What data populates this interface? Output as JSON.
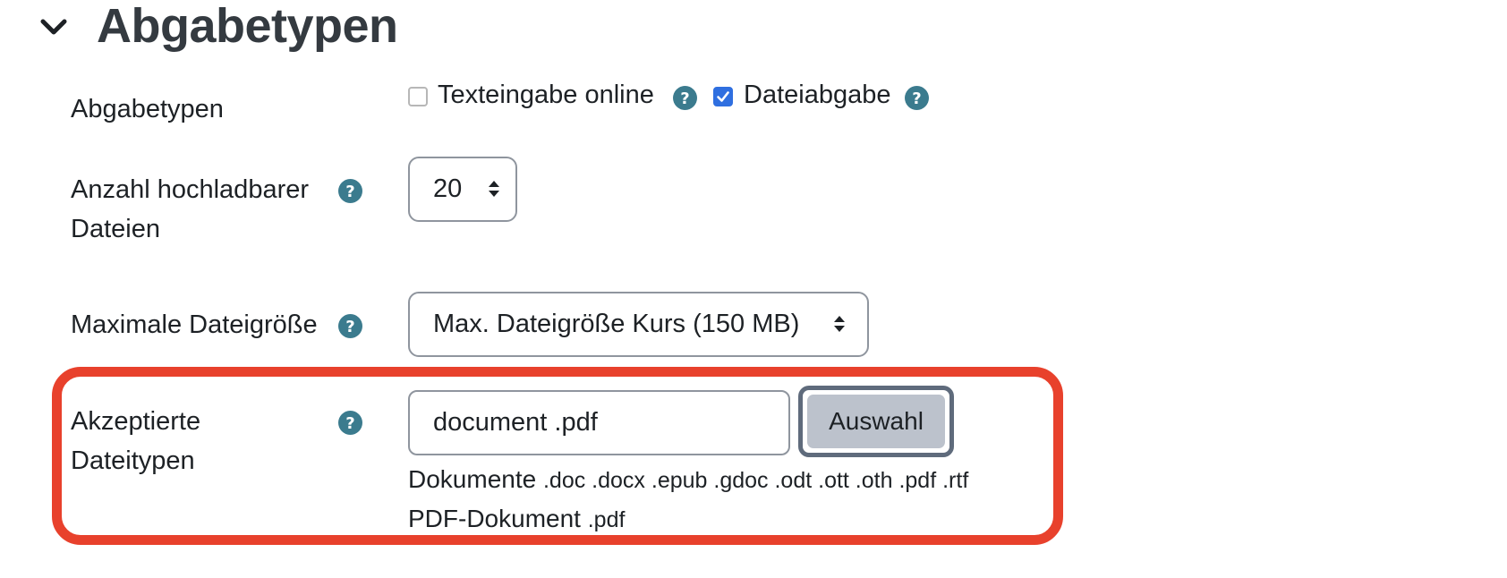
{
  "section": {
    "title": "Abgabetypen",
    "chevron_icon": "chevron-down-icon"
  },
  "submission_types": {
    "label": "Abgabetypen",
    "options": [
      {
        "label": "Texteingabe online",
        "checked": false,
        "help_icon": "help-icon"
      },
      {
        "label": "Dateiabgabe",
        "checked": true,
        "help_icon": "help-icon"
      }
    ]
  },
  "max_files": {
    "label_line1": "Anzahl hochladbarer",
    "label_line2": "Dateien",
    "value": "20",
    "help_icon": "help-icon"
  },
  "max_size": {
    "label": "Maximale Dateigröße",
    "value": "Max. Dateigröße Kurs (150 MB)",
    "help_icon": "help-icon"
  },
  "accepted_types": {
    "label_line1": "Akzeptierte",
    "label_line2": "Dateitypen",
    "value": "document .pdf",
    "choose_button": "Auswahl",
    "help_icon": "help-icon",
    "groups": [
      {
        "name": "Dokumente",
        "extensions": ".doc .docx .epub .gdoc .odt .ott .oth .pdf .rtf"
      },
      {
        "name": "PDF-Dokument",
        "extensions": ".pdf"
      }
    ]
  },
  "colors": {
    "help_icon": "#3b7b8e",
    "checkbox_checked": "#2f6fe0",
    "highlight_border": "#e8412c",
    "button_bg": "#bcc2cc",
    "title": "#343a40"
  }
}
